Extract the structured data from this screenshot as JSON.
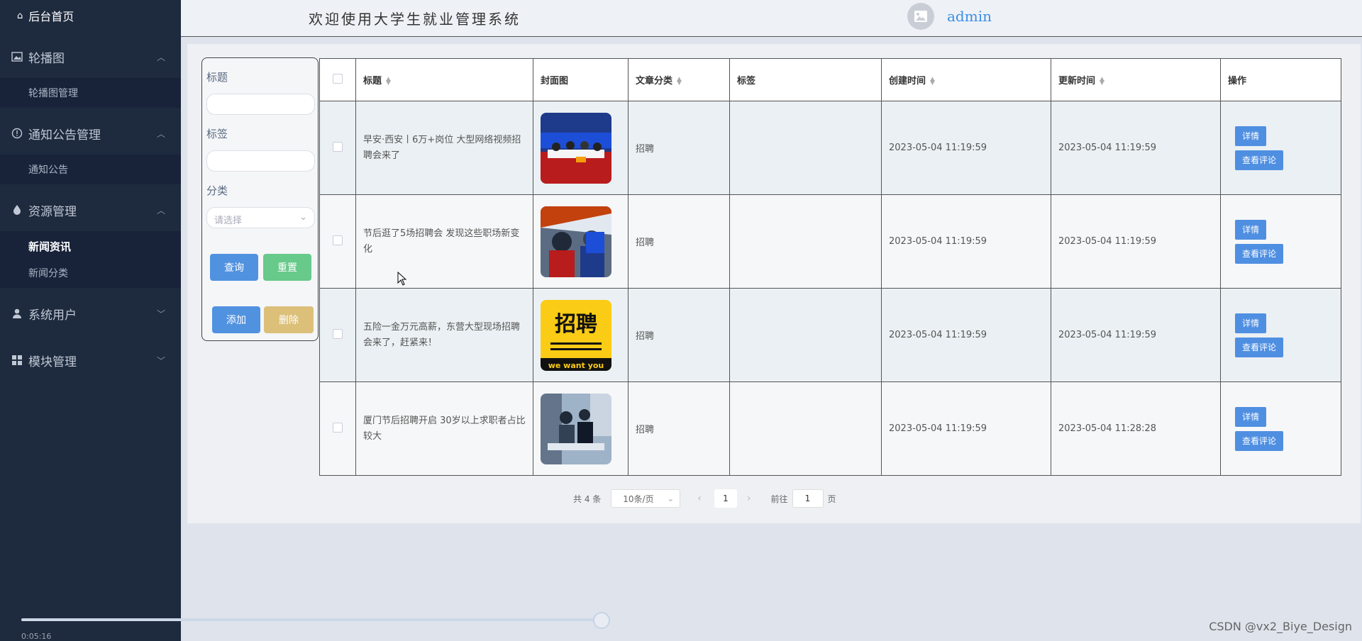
{
  "sidebar": {
    "home": "后台首页",
    "groups": [
      {
        "label": "轮播图",
        "icon": "image-icon",
        "items": [
          {
            "label": "轮播图管理"
          }
        ]
      },
      {
        "label": "通知公告管理",
        "icon": "info-icon",
        "items": [
          {
            "label": "通知公告"
          }
        ]
      },
      {
        "label": "资源管理",
        "icon": "drop-icon",
        "items": [
          {
            "label": "新闻资讯"
          },
          {
            "label": "新闻分类"
          }
        ]
      },
      {
        "label": "系统用户",
        "icon": "user-icon",
        "items": []
      },
      {
        "label": "模块管理",
        "icon": "grid-icon",
        "items": []
      }
    ]
  },
  "header": {
    "title": "欢迎使用大学生就业管理系统",
    "username": "admin"
  },
  "search": {
    "title_label": "标题",
    "tag_label": "标签",
    "category_label": "分类",
    "category_placeholder": "请选择",
    "query": "查询",
    "reset": "重置",
    "add": "添加",
    "delete": "删除"
  },
  "table": {
    "headers": [
      "标题",
      "封面图",
      "文章分类",
      "标签",
      "创建时间",
      "更新时间",
      "操作"
    ],
    "rows": [
      {
        "title": "早安·西安丨6万+岗位 大型网络视频招聘会来了",
        "category": "招聘",
        "tag": "",
        "created": "2023-05-04 11:19:59",
        "updated": "2023-05-04 11:19:59"
      },
      {
        "title": "节后逛了5场招聘会 发现这些职场新变化",
        "category": "招聘",
        "tag": "",
        "created": "2023-05-04 11:19:59",
        "updated": "2023-05-04 11:19:59"
      },
      {
        "title": "五险一金万元高薪，东营大型现场招聘会来了，赶紧来！",
        "category": "招聘",
        "tag": "",
        "created": "2023-05-04 11:19:59",
        "updated": "2023-05-04 11:19:59"
      },
      {
        "title": "厦门节后招聘开启 30岁以上求职者占比较大",
        "category": "招聘",
        "tag": "",
        "created": "2023-05-04 11:19:59",
        "updated": "2023-05-04 11:28:28"
      }
    ],
    "detail_label": "详情",
    "comments_label": "查看评论"
  },
  "pager": {
    "total": "共 4 条",
    "page_size": "10条/页",
    "current": "1",
    "goto_prefix": "前往",
    "goto_value": "1",
    "goto_suffix": "页"
  },
  "thumbnails": {
    "row3_text1": "招聘",
    "row3_text2": "we want you"
  },
  "player": {
    "time": "0:05:16"
  },
  "watermark": "CSDN @vx2_Biye_Design"
}
